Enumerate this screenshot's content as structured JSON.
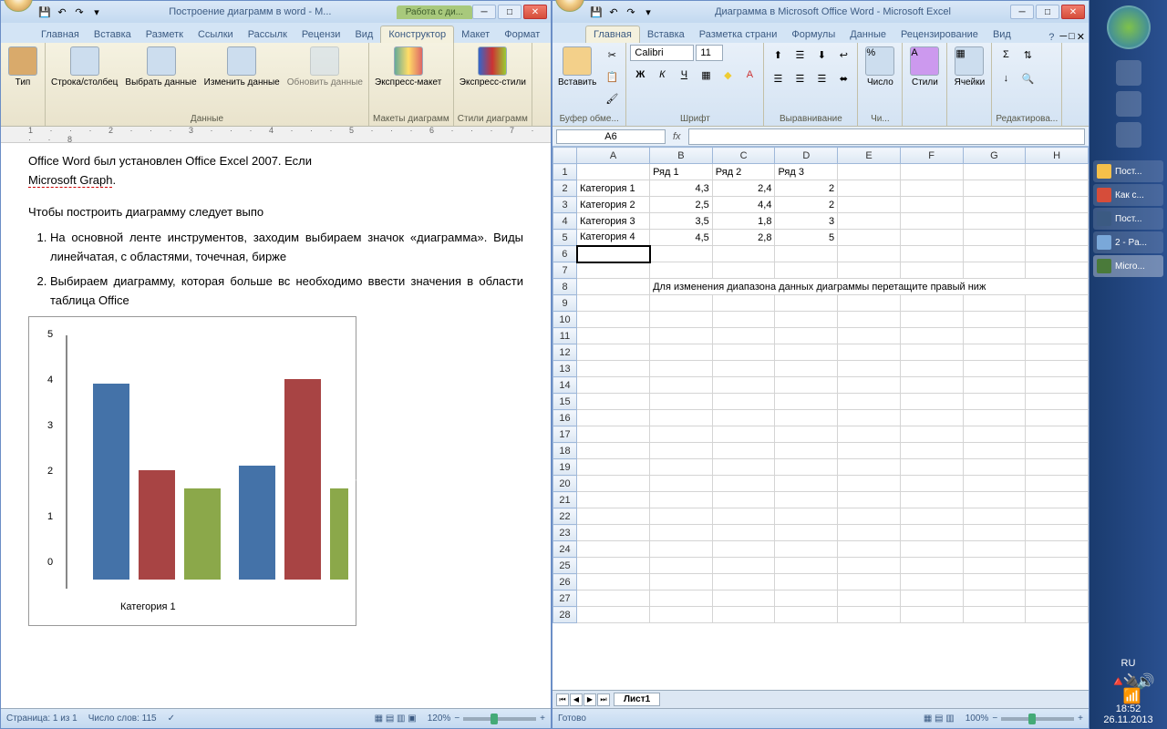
{
  "word": {
    "title": "Построение диаграмм в word - М...",
    "contextTab": "Работа с ди...",
    "tabs": [
      "Главная",
      "Вставка",
      "Разметк",
      "Ссылки",
      "Рассылк",
      "Рецензи",
      "Вид",
      "Конструктор",
      "Макет",
      "Формат"
    ],
    "activeTab": 8,
    "ribbon": {
      "g1": {
        "label": "",
        "btn": "Тип"
      },
      "g2": {
        "label": "Данные",
        "btns": [
          "Строка/столбец",
          "Выбрать данные",
          "Изменить данные",
          "Обновить данные"
        ]
      },
      "g3": {
        "label": "Макеты диаграмм",
        "btn": "Экспресс-макет"
      },
      "g4": {
        "label": "Стили диаграмм",
        "btn": "Экспресс-стили"
      }
    },
    "ruler": "1 · · · 2 · · · 3 · · · 4 · · · 5 · · · 6 · · · 7 · · · 8",
    "doc": {
      "p1a": "Office Word был установлен Office Excel 2007. Если",
      "p1b": "Microsoft Graph",
      "p2": "Чтобы  построить диаграмму следует выпо",
      "li1": "На основной ленте инструментов, заходим выбираем значок «диаграмма». Виды линейчатая, с областями, точечная, бирже",
      "li2": "Выбираем диаграмму, которая больше вс необходимо ввести значения в области таблица                                          Office",
      "chartCat": "Категория 1"
    },
    "status": {
      "page": "Страница: 1 из 1",
      "words": "Число слов: 115",
      "zoom": "120%"
    }
  },
  "excel": {
    "title": "Диаграмма в Microsoft Office Word - Microsoft Excel",
    "tabs": [
      "Главная",
      "Вставка",
      "Разметка страни",
      "Формулы",
      "Данные",
      "Рецензирование",
      "Вид"
    ],
    "activeTab": 0,
    "ribbon": {
      "g1": {
        "label": "Буфер обме...",
        "btn": "Вставить"
      },
      "g2": {
        "label": "Шрифт",
        "font": "Calibri",
        "size": "11"
      },
      "g3": {
        "label": "Выравнивание"
      },
      "g4": {
        "label": "Чи...",
        "btn": "Число"
      },
      "g5": {
        "label": "",
        "btn": "Стили"
      },
      "g6": {
        "label": "",
        "btn": "Ячейки"
      },
      "g7": {
        "label": "Редактирова..."
      }
    },
    "namebox": "A6",
    "cols": [
      "A",
      "B",
      "C",
      "D",
      "E",
      "F",
      "G",
      "H"
    ],
    "headers": [
      "",
      "Ряд 1",
      "Ряд 2",
      "Ряд 3"
    ],
    "rows": [
      {
        "n": 1,
        "c": [
          "",
          "Ряд 1",
          "Ряд 2",
          "Ряд 3",
          "",
          "",
          "",
          "",
          ""
        ]
      },
      {
        "n": 2,
        "c": [
          "Категория 1",
          "4,3",
          "2,4",
          "2",
          "",
          "",
          "",
          "",
          ""
        ]
      },
      {
        "n": 3,
        "c": [
          "Категория 2",
          "2,5",
          "4,4",
          "2",
          "",
          "",
          "",
          "",
          ""
        ]
      },
      {
        "n": 4,
        "c": [
          "Категория 3",
          "3,5",
          "1,8",
          "3",
          "",
          "",
          "",
          "",
          ""
        ]
      },
      {
        "n": 5,
        "c": [
          "Категория 4",
          "4,5",
          "2,8",
          "5",
          "",
          "",
          "",
          "",
          ""
        ]
      }
    ],
    "hint": "Для изменения диапазона данных диаграммы перетащите правый ниж",
    "sheet": "Лист1",
    "status": {
      "ready": "Готово",
      "zoom": "100%"
    }
  },
  "taskbar": {
    "items": [
      {
        "label": "Пост...",
        "color": "#f5c04a"
      },
      {
        "label": "Как с...",
        "color": "#d64d3a"
      },
      {
        "label": "Пост...",
        "color": "#3b5a82"
      },
      {
        "label": "2 - Pa...",
        "color": "#7aa8d9"
      },
      {
        "label": "Micro...",
        "color": "#4a7a3a",
        "active": true
      }
    ],
    "lang": "RU",
    "time": "18:52",
    "date": "26.11.2013"
  },
  "chart_data": {
    "type": "bar",
    "categories": [
      "Категория 1",
      "Категория 2",
      "Категория 3",
      "Категория 4"
    ],
    "series": [
      {
        "name": "Ряд 1",
        "values": [
          4.3,
          2.5,
          3.5,
          4.5
        ]
      },
      {
        "name": "Ряд 2",
        "values": [
          2.4,
          4.4,
          1.8,
          2.8
        ]
      },
      {
        "name": "Ряд 3",
        "values": [
          2,
          2,
          3,
          5
        ]
      }
    ],
    "ylim": [
      0,
      5
    ],
    "yticks": [
      0,
      1,
      2,
      3,
      4,
      5
    ]
  }
}
